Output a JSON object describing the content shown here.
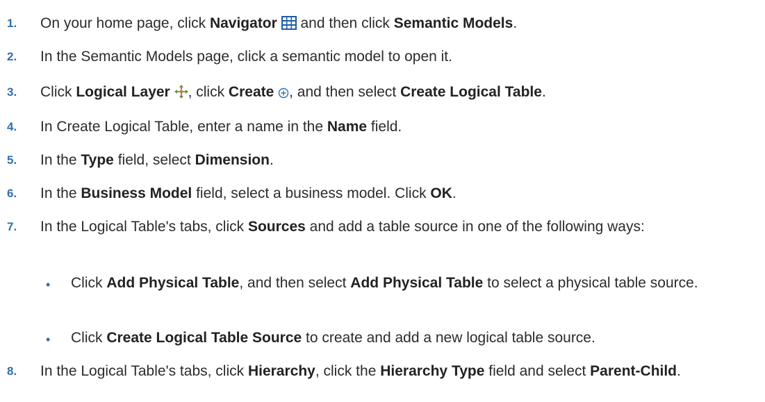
{
  "steps": [
    {
      "num": "1.",
      "p1": "On your home page, click ",
      "b1": "Navigator",
      "p2": " and then click ",
      "b2": "Semantic Models",
      "p3": "."
    },
    {
      "num": "2.",
      "p1": "In the Semantic Models page, click a semantic model to open it."
    },
    {
      "num": "3.",
      "p1": "Click ",
      "b1": "Logical Layer",
      "p2": ", click ",
      "b2": "Create",
      "p3": ", and then select ",
      "b3": "Create Logical Table",
      "p4": "."
    },
    {
      "num": "4.",
      "p1": "In Create Logical Table, enter a name in the ",
      "b1": "Name",
      "p2": " field."
    },
    {
      "num": "5.",
      "p1": "In the ",
      "b1": "Type",
      "p2": " field, select ",
      "b2": "Dimension",
      "p3": "."
    },
    {
      "num": "6.",
      "p1": "In the ",
      "b1": "Business Model",
      "p2": " field, select a business model. Click ",
      "b2": "OK",
      "p3": "."
    },
    {
      "num": "7.",
      "p1": "In the Logical Table's tabs, click ",
      "b1": "Sources",
      "p2": " and add a table source in one of the following ways:"
    },
    {
      "num": "8.",
      "p1": "In the Logical Table's tabs, click ",
      "b1": "Hierarchy",
      "p2": ", click the ",
      "b2": "Hierarchy Type",
      "p3": " field and select ",
      "b3": "Parent-Child",
      "p4": "."
    }
  ],
  "bullets": [
    {
      "mark": "•",
      "p1": "Click ",
      "b1": "Add Physical Table",
      "p2": ", and then select ",
      "b2": "Add Physical Table",
      "p3": " to select a physical table source."
    },
    {
      "mark": "•",
      "p1": "Click ",
      "b1": "Create Logical Table Source",
      "p2": " to create and add a new logical table source."
    }
  ],
  "colors": {
    "step_number": "#2f6fad",
    "text": "#2b2b2b",
    "navigator_icon": "#1f5aa6",
    "create_icon": "#2f6fad"
  },
  "icons": {
    "navigator": "grid-icon",
    "logical_layer": "move-arrows-icon",
    "create": "add-circle-icon"
  }
}
